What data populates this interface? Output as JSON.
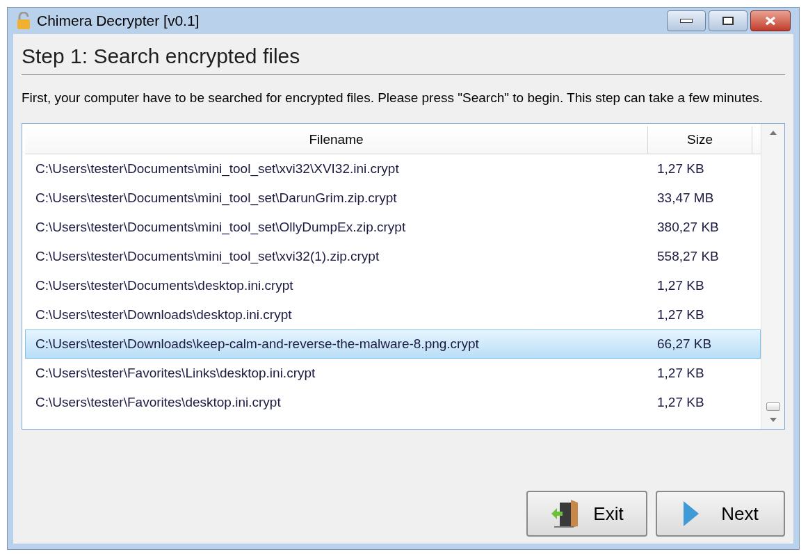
{
  "window": {
    "title": "Chimera Decrypter [v0.1]"
  },
  "heading": "Step 1: Search encrypted files",
  "description": "First, your computer have to be searched for encrypted files. Please press \"Search\" to begin. This step can take a few minutes.",
  "table": {
    "columns": [
      "Filename",
      "Size"
    ],
    "rows": [
      {
        "filename": "C:\\Users\\tester\\Documents\\mini_tool_set\\xvi32\\XVI32.ini.crypt",
        "size": "1,27 KB",
        "selected": false
      },
      {
        "filename": "C:\\Users\\tester\\Documents\\mini_tool_set\\DarunGrim.zip.crypt",
        "size": "33,47 MB",
        "selected": false
      },
      {
        "filename": "C:\\Users\\tester\\Documents\\mini_tool_set\\OllyDumpEx.zip.crypt",
        "size": "380,27 KB",
        "selected": false
      },
      {
        "filename": "C:\\Users\\tester\\Documents\\mini_tool_set\\xvi32(1).zip.crypt",
        "size": "558,27 KB",
        "selected": false
      },
      {
        "filename": "C:\\Users\\tester\\Documents\\desktop.ini.crypt",
        "size": "1,27 KB",
        "selected": false
      },
      {
        "filename": "C:\\Users\\tester\\Downloads\\desktop.ini.crypt",
        "size": "1,27 KB",
        "selected": false
      },
      {
        "filename": "C:\\Users\\tester\\Downloads\\keep-calm-and-reverse-the-malware-8.png.crypt",
        "size": "66,27 KB",
        "selected": true
      },
      {
        "filename": "C:\\Users\\tester\\Favorites\\Links\\desktop.ini.crypt",
        "size": "1,27 KB",
        "selected": false
      },
      {
        "filename": "C:\\Users\\tester\\Favorites\\desktop.ini.crypt",
        "size": "1,27 KB",
        "selected": false
      }
    ]
  },
  "buttons": [
    {
      "kind": "exit",
      "label": "Exit"
    },
    {
      "kind": "next",
      "label": "Next"
    }
  ]
}
